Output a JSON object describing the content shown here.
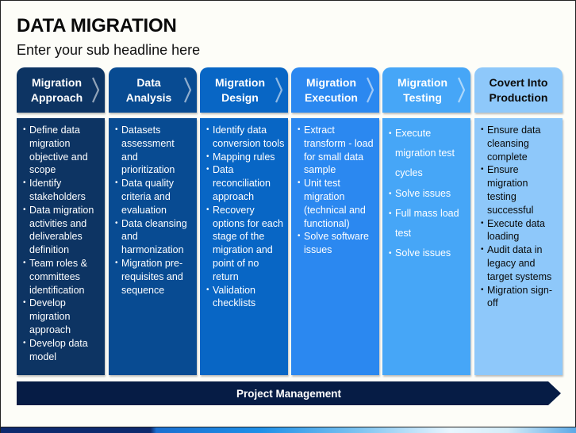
{
  "slide": {
    "title": "DATA MIGRATION",
    "subtitle": "Enter your sub headline here"
  },
  "stages": [
    {
      "header": "Migration Approach",
      "header_color": "#0d3463",
      "body_color": "#0d3463",
      "text_color": "#ffffff",
      "has_chevron": true,
      "items": [
        "Define data migration objective and scope",
        "Identify stakeholders",
        "Data migration activities and deliverables definition",
        "Team roles & committees identification",
        "Develop migration approach",
        "Develop data model"
      ]
    },
    {
      "header": "Data Analysis",
      "header_color": "#084b92",
      "body_color": "#084b92",
      "text_color": "#ffffff",
      "has_chevron": true,
      "items": [
        "Datasets assessment and prioritization",
        "Data quality criteria and evaluation",
        "Data cleansing and harmonization",
        "Migration pre-requisites and sequence"
      ]
    },
    {
      "header": "Migration Design",
      "header_color": "#0866c5",
      "body_color": "#0866c5",
      "text_color": "#ffffff",
      "has_chevron": true,
      "items": [
        "Identify data conversion tools",
        "Mapping rules",
        "Data reconciliation approach",
        "Recovery options for each stage of the migration and point of no return",
        "Validation checklists"
      ]
    },
    {
      "header": "Migration Execution",
      "header_color": "#2b88f0",
      "body_color": "#2b88f0",
      "text_color": "#ffffff",
      "has_chevron": true,
      "items": [
        "Extract transform - load for small data sample",
        "Unit test migration (technical and functional)",
        "Solve software issues"
      ]
    },
    {
      "header": "Migration Testing",
      "header_color": "#46a6f7",
      "body_color": "#46a6f7",
      "text_color": "#ffffff",
      "has_chevron": true,
      "items": [
        "Execute migration test cycles",
        "Solve issues",
        "Full mass load test",
        "Solve issues"
      ]
    },
    {
      "header": "Covert Into Production",
      "header_color": "#8ec8fa",
      "body_color": "#8ec8fa",
      "text_color": "#0a0a0a",
      "has_chevron": false,
      "items": [
        "Ensure data cleansing complete",
        "Ensure migration testing successful",
        "Execute data loading",
        "Audit data in legacy and target systems",
        "Migration sign-off"
      ]
    }
  ],
  "project_management": {
    "label": "Project Management",
    "color": "#061c45"
  }
}
